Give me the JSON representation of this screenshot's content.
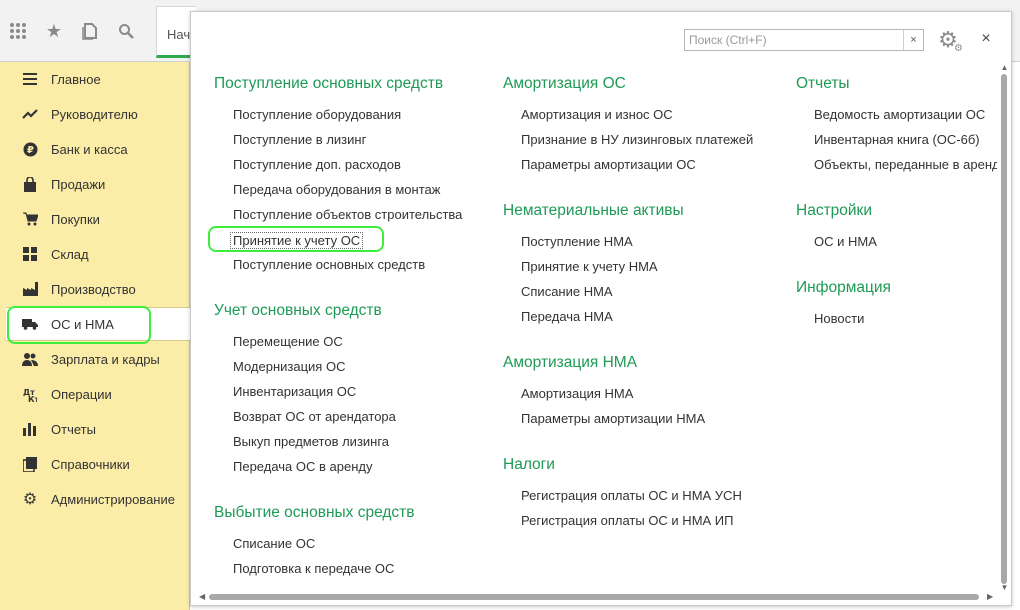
{
  "topbar": {
    "icons": [
      "apps-grid-icon",
      "star-icon",
      "history-icon",
      "search-icon"
    ],
    "tab_label": "Нач"
  },
  "sidebar": {
    "items": [
      {
        "label": "Главное",
        "icon": "menu-lines-icon"
      },
      {
        "label": "Руководителю",
        "icon": "trend-icon"
      },
      {
        "label": "Банк и касса",
        "icon": "ruble-coin-icon"
      },
      {
        "label": "Продажи",
        "icon": "shopping-bag-icon"
      },
      {
        "label": "Покупки",
        "icon": "cart-icon"
      },
      {
        "label": "Склад",
        "icon": "warehouse-icon"
      },
      {
        "label": "Производство",
        "icon": "factory-icon"
      },
      {
        "label": "ОС и НМА",
        "icon": "truck-icon"
      },
      {
        "label": "Зарплата и кадры",
        "icon": "people-icon"
      },
      {
        "label": "Операции",
        "icon": "debit-credit-icon"
      },
      {
        "label": "Отчеты",
        "icon": "bar-chart-icon"
      },
      {
        "label": "Справочники",
        "icon": "books-icon"
      },
      {
        "label": "Администрирование",
        "icon": "gear-icon"
      }
    ],
    "active_index": 7
  },
  "panel": {
    "search_placeholder": "Поиск (Ctrl+F)",
    "search_clear": "×",
    "close": "×",
    "col1": {
      "s1": {
        "title": "Поступление основных средств",
        "links": [
          "Поступление оборудования",
          "Поступление в лизинг",
          "Поступление доп. расходов",
          "Передача оборудования в монтаж",
          "Поступление объектов строительства",
          "Принятие к учету ОС",
          "Поступление основных средств"
        ]
      },
      "s2": {
        "title": "Учет основных средств",
        "links": [
          "Перемещение ОС",
          "Модернизация ОС",
          "Инвентаризация ОС",
          "Возврат ОС от арендатора",
          "Выкуп предметов лизинга",
          "Передача ОС в аренду"
        ]
      },
      "s3": {
        "title": "Выбытие основных средств",
        "links": [
          "Списание ОС",
          "Подготовка к передаче ОС"
        ]
      }
    },
    "col2": {
      "s1": {
        "title": "Амортизация ОС",
        "links": [
          "Амортизация и износ ОС",
          "Признание в НУ лизинговых платежей",
          "Параметры амортизации ОС"
        ]
      },
      "s2": {
        "title": "Нематериальные активы",
        "links": [
          "Поступление НМА",
          "Принятие к учету НМА",
          "Списание НМА",
          "Передача НМА"
        ]
      },
      "s3": {
        "title": "Амортизация НМА",
        "links": [
          "Амортизация НМА",
          "Параметры амортизации НМА"
        ]
      },
      "s4": {
        "title": "Налоги",
        "links": [
          "Регистрация оплаты ОС и НМА УСН",
          "Регистрация оплаты ОС и НМА ИП"
        ]
      }
    },
    "col3": {
      "s1": {
        "title": "Отчеты",
        "links": [
          "Ведомость амортизации ОС",
          "Инвентарная книга (ОС-6б)",
          "Объекты, переданные в аренду"
        ]
      },
      "s2": {
        "title": "Настройки",
        "links": [
          "ОС и НМА"
        ]
      },
      "s3": {
        "title": "Информация",
        "links": [
          "Новости"
        ]
      }
    }
  },
  "colors": {
    "section_title": "#1e9a55",
    "sidebar_bg": "#fbeda7",
    "highlight": "#3dee3d",
    "tab_underline": "#2fa84f"
  }
}
